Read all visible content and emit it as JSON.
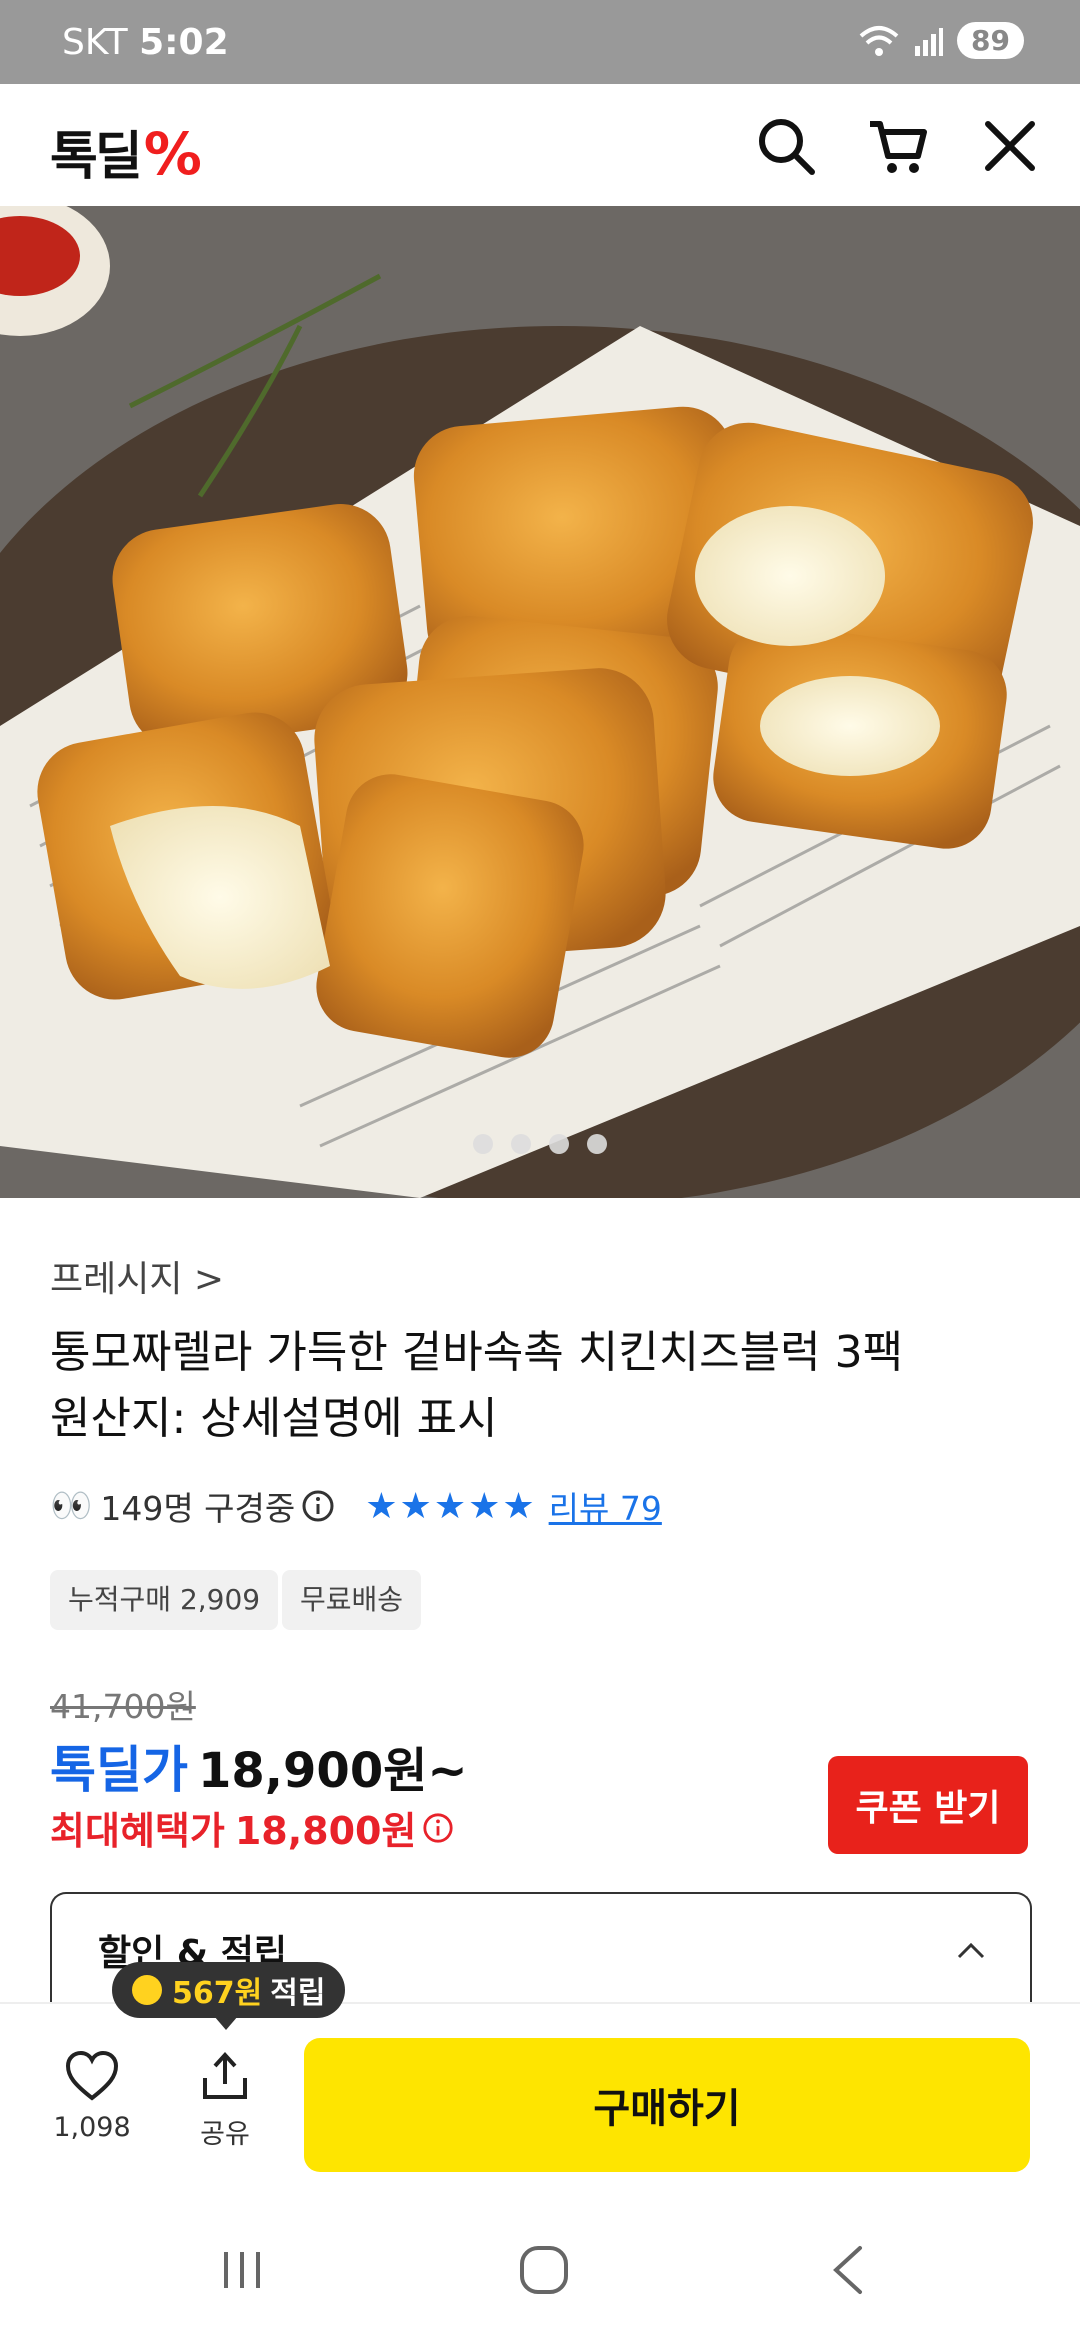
{
  "status_bar": {
    "carrier": "SKT",
    "time": "5:02",
    "battery": "89"
  },
  "header": {
    "logo_text": "톡딜",
    "logo_mark": "%"
  },
  "hero": {
    "page_count": 4
  },
  "product": {
    "brand": "프레시지 >",
    "title_line1": "통모짜렐라 가득한 겉바속촉 치킨치즈블럭 3팩",
    "title_line2": "원산지: 상세설명에 표시",
    "viewers": "149명 구경중",
    "rating_stars": "★★★★★",
    "review_label": "리뷰 79",
    "tags": [
      "누적구매 2,909",
      "무료배송"
    ],
    "original_price": "41,700원",
    "deal_label": "톡딜가",
    "deal_price": "18,900원~",
    "max_benefit_label": "최대혜택가",
    "max_benefit_price": "18,800원"
  },
  "coupon_button": "쿠폰 받기",
  "benefit": {
    "title": "할인 & 적립"
  },
  "tooltip": {
    "amount": "567원",
    "text": "적립"
  },
  "bottom": {
    "like_count": "1,098",
    "share_label": "공유",
    "buy_label": "구매하기"
  },
  "colors": {
    "accent_red": "#e8221b",
    "deal_blue": "#1565e5",
    "buy_yellow": "#fee500"
  }
}
